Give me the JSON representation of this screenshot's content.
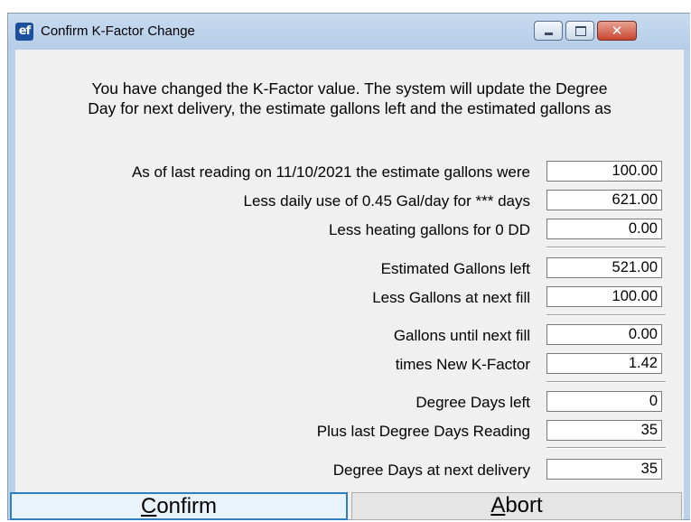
{
  "window": {
    "title": "Confirm K-Factor Change",
    "app_icon": "ef",
    "close_glyph": "✕"
  },
  "message": {
    "line1": "You have changed the K-Factor value. The system will update the Degree",
    "line2": "Day for next delivery, the estimate gallons left and the estimated gallons as"
  },
  "rows": [
    {
      "label": "As of last reading on 11/10/2021 the estimate gallons were",
      "value": "100.00"
    },
    {
      "label": "Less daily use of 0.45 Gal/day for *** days",
      "value": "621.00"
    },
    {
      "label": "Less heating gallons for 0 DD",
      "value": "0.00"
    },
    {
      "label": "Estimated Gallons left",
      "value": "521.00"
    },
    {
      "label": "Less Gallons at next fill",
      "value": "100.00"
    },
    {
      "label": "Gallons until next fill",
      "value": "0.00"
    },
    {
      "label": "times New K-Factor",
      "value": "1.42"
    },
    {
      "label": "Degree Days left",
      "value": "0"
    },
    {
      "label": "Plus last Degree Days Reading",
      "value": "35"
    },
    {
      "label": "Degree Days at next delivery",
      "value": "35"
    }
  ],
  "buttons": {
    "confirm": {
      "mnemonic": "C",
      "rest": "onfirm"
    },
    "abort": {
      "mnemonic": "A",
      "rest": "bort"
    }
  }
}
